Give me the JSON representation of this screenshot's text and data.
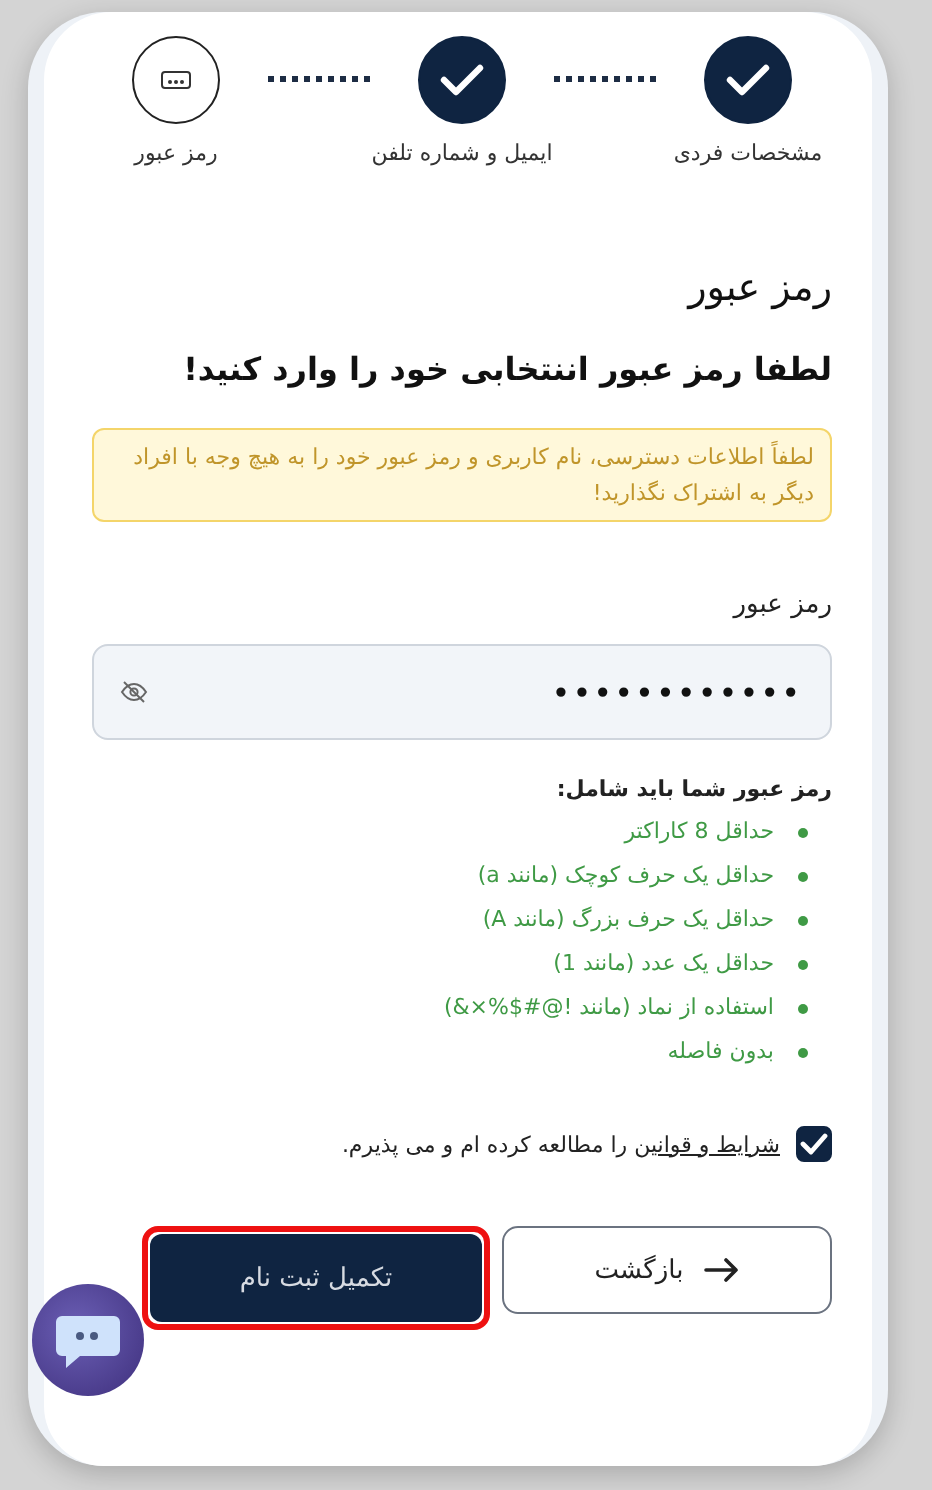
{
  "steps": [
    {
      "label": "مشخصات فردی",
      "done": true
    },
    {
      "label": "ایمیل و شماره تلفن",
      "done": true
    },
    {
      "label": "رمز عبور",
      "done": false
    }
  ],
  "title": "رمز عبور",
  "subtitle": "لطفا رمز عبور اننتخابی خود را وارد کنید!",
  "warning": "لطفاً اطلاعات دسترسی، نام کاربری و رمز عبور خود را به هیچ وجه با افراد دیگر به اشتراک نگذارید!",
  "password_field": {
    "label": "رمز عبور",
    "value": "••••••••••••"
  },
  "requirements": {
    "heading": "رمز عبور شما باید شامل:",
    "items": [
      {
        "text": "حداقل 8 کاراکتر",
        "met": true
      },
      {
        "text": "حداقل یک حرف کوچک (مانند a)",
        "met": true
      },
      {
        "text": "حداقل یک حرف بزرگ (مانند A)",
        "met": true
      },
      {
        "text": "حداقل یک عدد (مانند 1)",
        "met": true
      },
      {
        "text": "استفاده از نماد (مانند !@#$%×&)",
        "met": true
      },
      {
        "text": "بدون فاصله",
        "met": true
      }
    ]
  },
  "terms": {
    "checked": true,
    "link": "شرایط و قوانین",
    "text": "را مطالعه کرده ام و می پذیرم."
  },
  "buttons": {
    "back": "بازگشت",
    "submit": "تکمیل ثبت نام",
    "submit_highlighted": true
  }
}
